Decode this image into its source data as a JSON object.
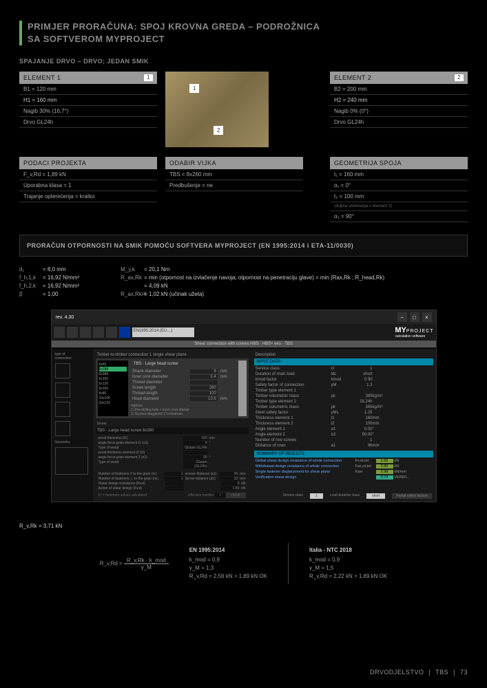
{
  "title_line1": "PRIMJER PRORAČUNA: SPOJ KROVNA GREDA – PODROŽNICA",
  "title_line2": "SA SOFTVEROM MYPROJECT",
  "subsection": "SPAJANJE DRVO – DRVO; JEDAN SMIK",
  "element1": {
    "header": "ELEMENT 1",
    "num": "1",
    "rows": [
      "B1 = 120 mm",
      "H1 = 160 mm",
      "Nagib 30% (16,7°)",
      "Drvo GL24h"
    ]
  },
  "element2": {
    "header": "ELEMENT 2",
    "num": "2",
    "rows": [
      "B2 = 200 mm",
      "H2 = 240 mm",
      "Nagib 0% (0°)",
      "Drvo GL24h"
    ]
  },
  "projdata": {
    "header": "PODACI PROJEKTA",
    "rows": [
      "F_v,Rd = 1,89 kN",
      "Uporabna klasa = 1",
      "Trajanje opterećenja = kratko"
    ]
  },
  "screw": {
    "header": "ODABIR VIJKA",
    "rows": [
      "TBS = 8x260 mm",
      "Predbušenje = ne"
    ]
  },
  "geom": {
    "header": "GEOMETRIJA SPOJA",
    "rows": [
      "t₁ = 160 mm",
      "α₁ = 0°",
      "t₂ = 100 mm",
      "(duljina utiskivanja u element 2)",
      "α₂ = 90°"
    ]
  },
  "calc_title": "PRORAČUN OTPORNOSTI NA SMIK POMOĆU SOFTVERA MYPROJECT (EN 1995:2014 i ETA-11/0030)",
  "params": {
    "col1": [
      {
        "l": "d₁",
        "v": "= 8,0 mm"
      },
      {
        "l": "f_h,1,k",
        "v": "= 16,92 N/mm²"
      },
      {
        "l": "f_h,2,k",
        "v": "= 16,92 N/mm²"
      },
      {
        "l": "β",
        "v": "= 1,00"
      }
    ],
    "col2": [
      {
        "l": "M_y,k",
        "v": "= 20,1 Nm"
      },
      {
        "l": "R_ax,Rk",
        "v": "= min (otpornost na izvlačenje navoja; otpornost na penetraciju glave) = min (Rax,Rk ; R_head,Rk)"
      },
      {
        "l": "",
        "v": "= 4,09 kN"
      },
      {
        "l": "R_ax,Rk/4",
        "v": "= 1,02 kN (učinak užeta)"
      }
    ]
  },
  "screenshot": {
    "version": "rev. 4.30",
    "norm_sel": "EN1995:2014 (EU…)",
    "logo": "MY",
    "logo_sub": "PROJECT",
    "logo_tag": "calculation software",
    "tab_title": "Shear connection with screws  HBS · HBS+ evo · TBS",
    "conn_type": "Timber-to-timber connection 1 single shear plane",
    "tbs_title": "TBS · Large head screw",
    "tbs_sizes": [
      "6x40",
      "6x288",
      "6x388",
      "6x100",
      "6x120",
      "6x160",
      "8x80",
      "10x100",
      "10x120"
    ],
    "tbs_sel": "6x288",
    "tbs_params": [
      {
        "k": "Shank diameter",
        "v": "8",
        "u": "mm"
      },
      {
        "k": "Inner core diameter",
        "v": "5.4",
        "u": "mm"
      },
      {
        "k": "Thread diameter",
        "v": "",
        "u": ""
      },
      {
        "k": "Screw length",
        "v": "260",
        "u": ""
      },
      {
        "k": "Thread length",
        "v": "100",
        "u": ""
      },
      {
        "k": "Head diameter",
        "v": "13.6",
        "u": "mm"
      }
    ],
    "tbs_options": [
      "Pre-drilling hole > inner core diamet",
      "Screws staggered 1°t minimum"
    ],
    "screw_label": "TBS - Large head screw 8x260",
    "bottom_rows": [
      {
        "k": "wood thickness (t1)",
        "v": "160",
        "u": "mm"
      },
      {
        "k": "angle force-grain element t1  (α1)",
        "v": "0",
        "u": "°"
      },
      {
        "k": "Type of wood",
        "v": "Glulam GL24h"
      },
      {
        "k": "wood thickness  element t2 (t2)",
        "v": "",
        "u": ""
      },
      {
        "k": "angle force-grain element 2  (α2)",
        "v": "90",
        "u": "°"
      },
      {
        "k": "Type of wood",
        "v": "Glulam (GL24h)"
      }
    ],
    "bottom_rows2": [
      {
        "k": "Number of fasteners // to the grain  (nr)",
        "v": "1",
        "k2": "screws distance (a1)",
        "v2": "96",
        "u": "mm"
      },
      {
        "k": "Number of fasteners ⊥ to the grain  (nc)",
        "v": "1",
        "k2": "Screw distance (a2)",
        "v2": "32",
        "u": "mm"
      },
      {
        "k": "Shear design resistance (Rv,d)",
        "v": "",
        "v2": "0",
        "u": "kN"
      },
      {
        "k": "Action of shear design (Fv,d)",
        "v": "",
        "v2": "1.89",
        "u": "kN"
      }
    ],
    "min_note": "(¹) = minimum values calculated",
    "eff_label": "Effective number",
    "eff_val": "1",
    "desc_title": "Description",
    "input_title": "INPUT DATA:",
    "input_rows": [
      {
        "k": "Service class",
        "s": "cl",
        "v": "1",
        "u": ""
      },
      {
        "k": "Duration of main load",
        "s": "ldc",
        "v": "short",
        "u": ""
      },
      {
        "k": "kmod factor",
        "s": "kmod",
        "v": "0.90",
        "u": ""
      },
      {
        "k": "Safety factor of connection",
        "s": "γM",
        "v": "1.3",
        "u": ""
      },
      {
        "k": "Timber type element 1",
        "s": "",
        "v": "",
        "u": ""
      },
      {
        "k": "Timber volumetric mass",
        "s": "ρk",
        "v": "385",
        "u": "kg/m³"
      },
      {
        "k": "Timber type element 2",
        "s": "",
        "v": "GL24h",
        "u": ""
      },
      {
        "k": "Timber volumetric mass",
        "s": "ρk",
        "v": "385",
        "u": "kg/m³"
      },
      {
        "k": "Steel safety factor",
        "s": "γMs",
        "v": "1.25",
        "u": ""
      },
      {
        "k": "Thickness element 1",
        "s": "t1",
        "v": "160",
        "u": "mm"
      },
      {
        "k": "Thickness element 2",
        "s": "t2",
        "v": "100",
        "u": "mm"
      },
      {
        "k": "Angle element 1",
        "s": "α1",
        "v": "0.00",
        "u": "°"
      },
      {
        "k": "Angle element 2",
        "s": "α2",
        "v": "90.00",
        "u": "°"
      },
      {
        "k": "Number of row screws",
        "s": "",
        "v": "1",
        "u": ""
      },
      {
        "k": "Distance of rows",
        "s": "a1",
        "v": "96",
        "u": "mm"
      }
    ],
    "sum_title": "SUMMARY OF RESULTS",
    "sum_rows": [
      {
        "k": "Global shear design resistance of whole connection",
        "s": "Fv,rd,tot",
        "v": "2.56",
        "u": "kN"
      },
      {
        "k": "Withdrawal design resistance of whole connection",
        "s": "Fax,rd,tot",
        "v": "2.83",
        "u": "kN"
      },
      {
        "k": "Single fastener displacement for shear plane",
        "s": "Kser",
        "v": "2.98",
        "u": "kN/mm"
      },
      {
        "k": "Verification shear design",
        "s": "",
        "v": "0.74",
        "u": "VERIFI…"
      }
    ],
    "bottom_bar": {
      "sc": "Service class",
      "sc_v": "1",
      "ld": "Load duration class",
      "ld_v": "short",
      "psf": "Partial safety factors"
    }
  },
  "rfx": "R_v,Rk = 3,71 kN",
  "formula": {
    "lhs": "R_v,Rd =",
    "top": "R_v,Rk · k_mod",
    "bot": "γ_M"
  },
  "std1": {
    "title": "EN 1995:2014",
    "rows": [
      "k_mod = 0,9",
      "γ_M = 1,3",
      "R_v,Rd = 2,56 kN > 1,89 kN OK"
    ]
  },
  "std2": {
    "title": "Italia - NTC 2018",
    "rows": [
      "k_mod = 0,9",
      "γ_M = 1,5",
      "R_v,Rd = 2,22 kN > 1,89 kN OK"
    ]
  },
  "footer": {
    "a": "DRVODJELSTVO",
    "b": "TBS",
    "c": "73"
  }
}
